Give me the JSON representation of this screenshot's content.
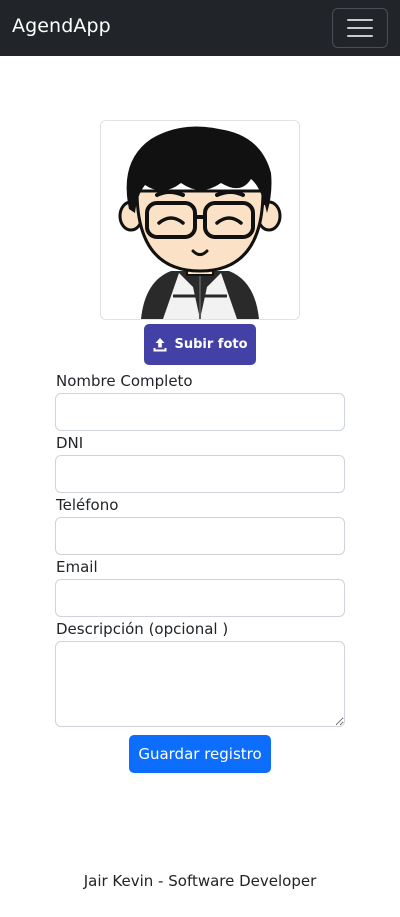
{
  "navbar": {
    "brand": "AgendApp",
    "toggle_icon": "hamburger-menu-icon"
  },
  "profile": {
    "avatar_icon": "cartoon-avatar-with-glasses",
    "upload_icon": "upload-icon",
    "upload_label": "Subir foto"
  },
  "form": {
    "fields": [
      {
        "label": "Nombre Completo",
        "value": ""
      },
      {
        "label": "DNI",
        "value": ""
      },
      {
        "label": "Teléfono",
        "value": ""
      },
      {
        "label": "Email",
        "value": ""
      },
      {
        "label": "Descripción (opcional )",
        "value": ""
      }
    ],
    "save_label": "Guardar registro"
  },
  "footer": {
    "text": "Jair Kevin - Software Developer"
  },
  "colors": {
    "navbar_bg": "#212529",
    "upload_button": "#4340a6",
    "primary_button": "#0d6efd"
  }
}
